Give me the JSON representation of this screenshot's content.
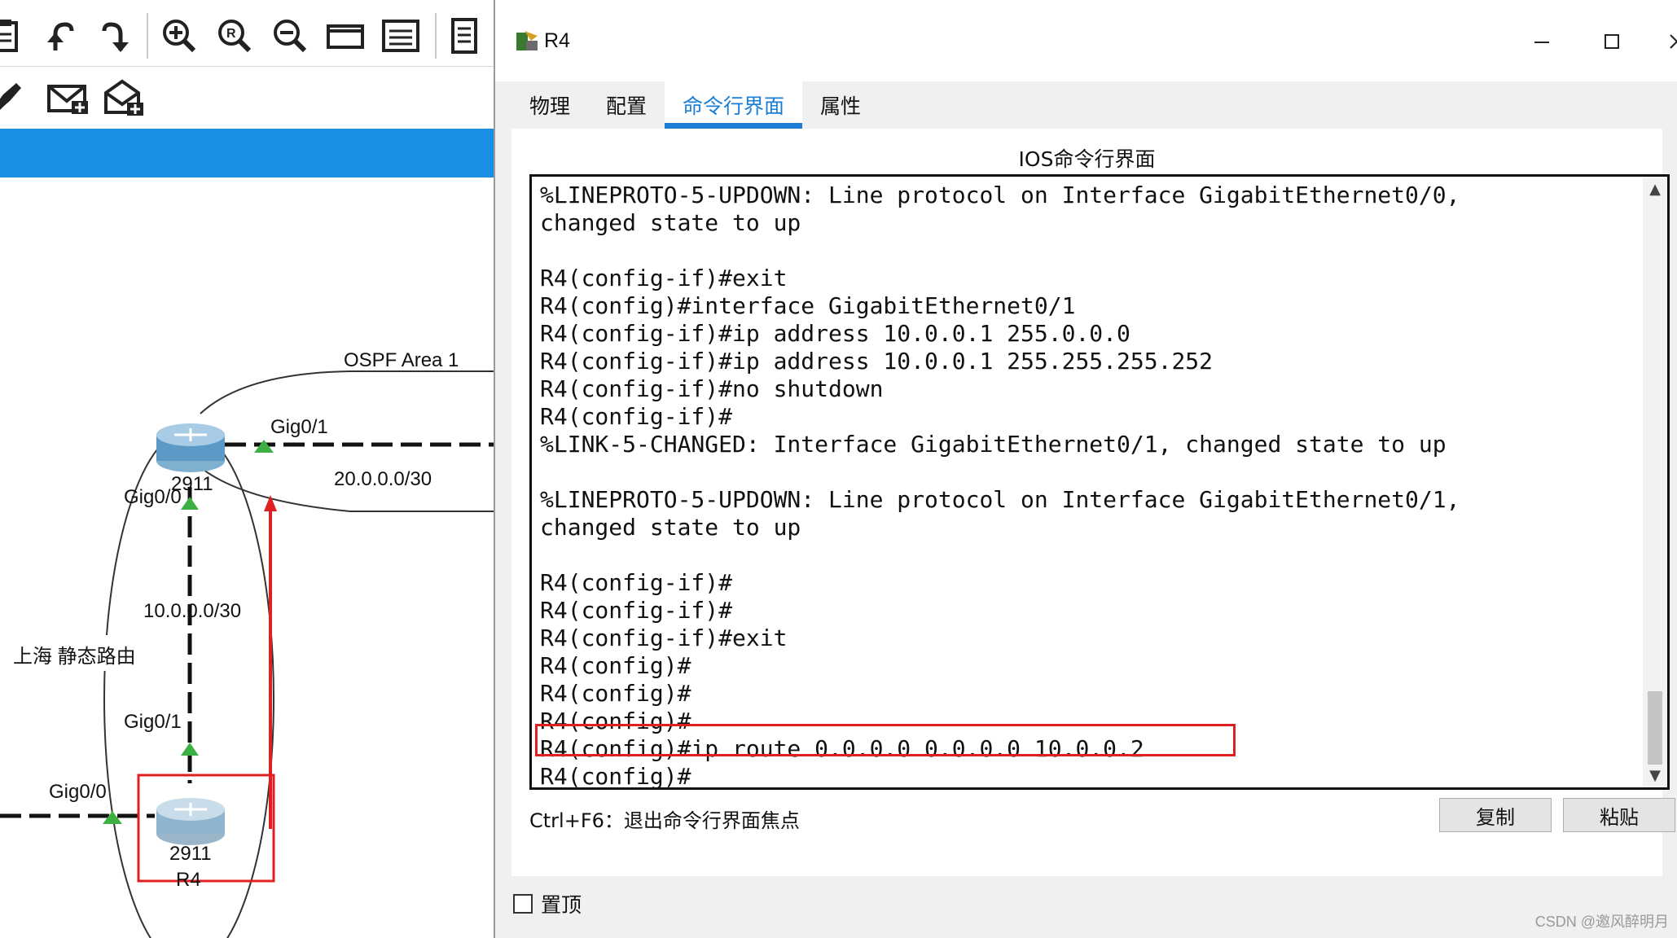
{
  "toolbar": {
    "row1_icons": [
      "clipboard-icon",
      "undo-icon",
      "redo-icon",
      "zoom-in-icon",
      "zoom-reset-icon",
      "zoom-out-icon",
      "window-icon",
      "palette-icon",
      "notes-icon"
    ],
    "row2_icons": [
      "draw-icon",
      "simple-pdu-icon",
      "complex-pdu-icon"
    ]
  },
  "topology": {
    "area_label": "OSPF Area 1",
    "top_router_model_partial": "2911",
    "top_router_gig01": "Gig0/1",
    "top_router_gig00": "Gig0/0",
    "link_20": "20.0.0.0/30",
    "link_10": "10.0.0.0/30",
    "region_label": "上海  静态路由",
    "r4_gig01": "Gig0/1",
    "r4_gig00": "Gig0/0",
    "r4_model": "2911",
    "r4_name": "R4",
    "colors": {
      "link": "#111111",
      "port": "#3cb043",
      "annotation": "#e02020"
    }
  },
  "dialog": {
    "title": "R4",
    "tabs": [
      {
        "label": "物理",
        "active": false
      },
      {
        "label": "配置",
        "active": false
      },
      {
        "label": "命令行界面",
        "active": true
      },
      {
        "label": "属性",
        "active": false
      }
    ],
    "ios_title": "IOS命令行界面",
    "terminal_lines": [
      "%LINEPROTO-5-UPDOWN: Line protocol on Interface GigabitEthernet0/0,",
      "changed state to up",
      "",
      "R4(config-if)#exit",
      "R4(config)#interface GigabitEthernet0/1",
      "R4(config-if)#ip address 10.0.0.1 255.0.0.0",
      "R4(config-if)#ip address 10.0.0.1 255.255.255.252",
      "R4(config-if)#no shutdown",
      "R4(config-if)#",
      "%LINK-5-CHANGED: Interface GigabitEthernet0/1, changed state to up",
      "",
      "%LINEPROTO-5-UPDOWN: Line protocol on Interface GigabitEthernet0/1,",
      "changed state to up",
      "",
      "R4(config-if)#",
      "R4(config-if)#",
      "R4(config-if)#exit",
      "R4(config)#",
      "R4(config)#",
      "R4(config)#",
      "R4(config)#ip route 0.0.0.0 0.0.0.0 10.0.0.2",
      "R4(config)#"
    ],
    "hint": "Ctrl+F6：退出命令行界面焦点",
    "copy_label": "复制",
    "paste_label": "粘贴",
    "pin_label": "置顶",
    "accent": "#1a7fd4"
  },
  "watermark": "CSDN @邀风醉明月"
}
